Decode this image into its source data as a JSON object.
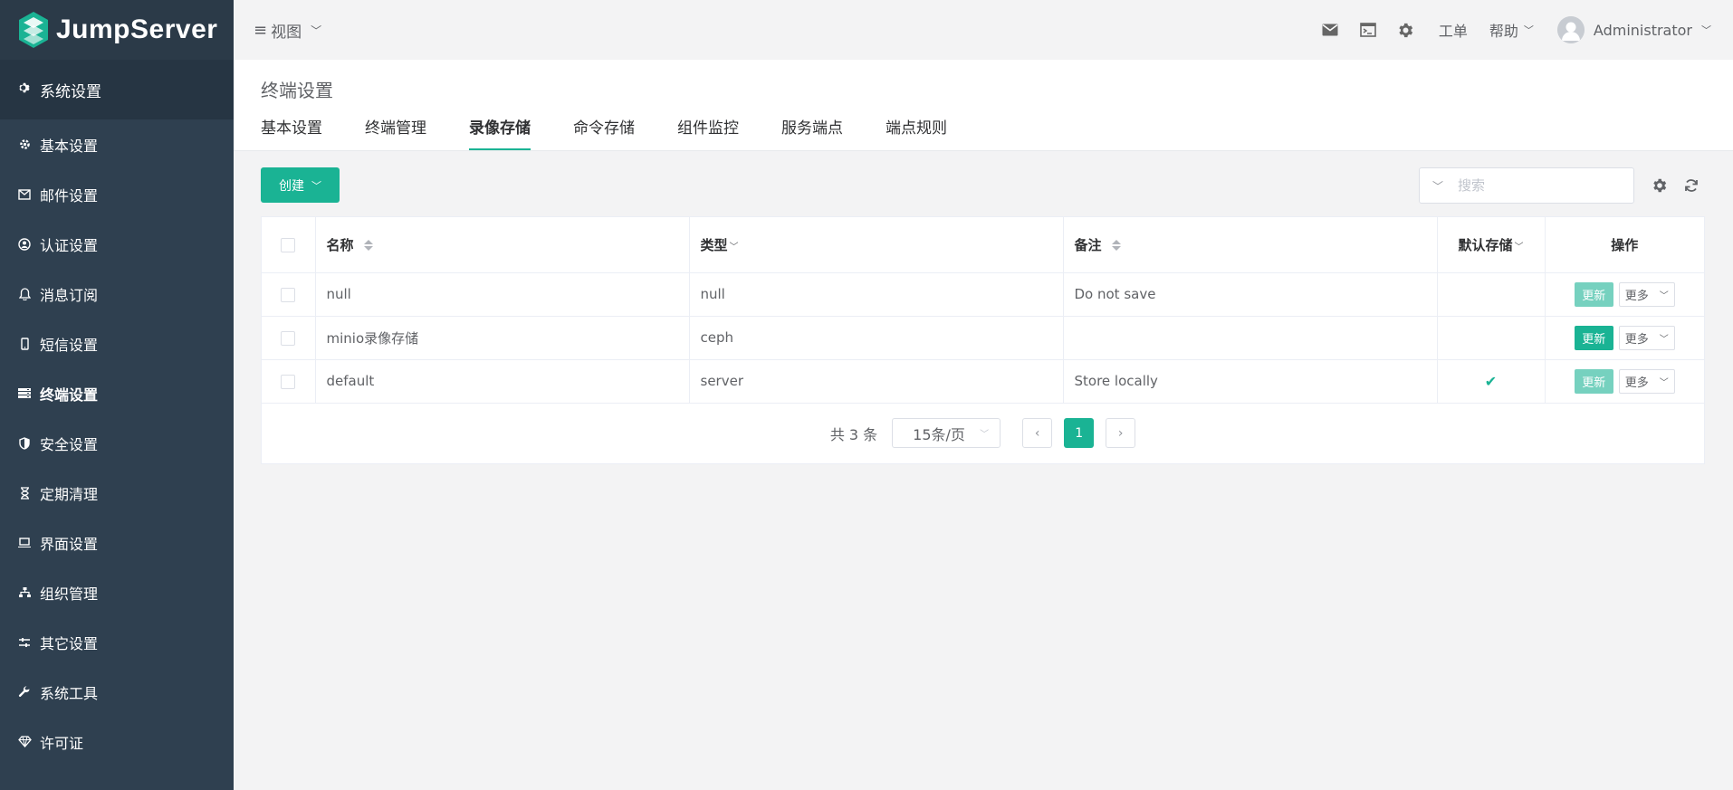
{
  "brand": {
    "name": "JumpServer"
  },
  "sidebar": {
    "section_title": "系统设置",
    "items": [
      {
        "label": "基本设置",
        "icon": "gear-icon",
        "active": false
      },
      {
        "label": "邮件设置",
        "icon": "envelope-icon",
        "active": false
      },
      {
        "label": "认证设置",
        "icon": "user-circle-icon",
        "active": false
      },
      {
        "label": "消息订阅",
        "icon": "bell-icon",
        "active": false
      },
      {
        "label": "短信设置",
        "icon": "mobile-icon",
        "active": false
      },
      {
        "label": "终端设置",
        "icon": "server-icon",
        "active": true
      },
      {
        "label": "安全设置",
        "icon": "shield-icon",
        "active": false
      },
      {
        "label": "定期清理",
        "icon": "hourglass-icon",
        "active": false
      },
      {
        "label": "界面设置",
        "icon": "laptop-icon",
        "active": false
      },
      {
        "label": "组织管理",
        "icon": "sitemap-icon",
        "active": false
      },
      {
        "label": "其它设置",
        "icon": "sliders-icon",
        "active": false
      },
      {
        "label": "系统工具",
        "icon": "wrench-icon",
        "active": false
      },
      {
        "label": "许可证",
        "icon": "diamond-icon",
        "active": false
      }
    ]
  },
  "topbar": {
    "view_label": "视图",
    "ticket_label": "工单",
    "help_label": "帮助",
    "user_name": "Administrator"
  },
  "page": {
    "title": "终端设置",
    "tabs": [
      {
        "label": "基本设置",
        "active": false
      },
      {
        "label": "终端管理",
        "active": false
      },
      {
        "label": "录像存储",
        "active": true
      },
      {
        "label": "命令存储",
        "active": false
      },
      {
        "label": "组件监控",
        "active": false
      },
      {
        "label": "服务端点",
        "active": false
      },
      {
        "label": "端点规则",
        "active": false
      }
    ]
  },
  "toolbar": {
    "create_label": "创建",
    "search_placeholder": "搜索"
  },
  "table": {
    "headers": {
      "name": "名称",
      "type": "类型",
      "comment": "备注",
      "default": "默认存储",
      "actions": "操作"
    },
    "rows": [
      {
        "name": "null",
        "type": "null",
        "comment": "Do not save",
        "is_default": false,
        "update_enabled": false
      },
      {
        "name": "minio录像存储",
        "type": "ceph",
        "comment": "",
        "is_default": false,
        "update_enabled": true
      },
      {
        "name": "default",
        "type": "server",
        "comment": "Store locally",
        "is_default": true,
        "update_enabled": false
      }
    ],
    "update_label": "更新",
    "more_label": "更多"
  },
  "pagination": {
    "total_text": "共 3 条",
    "page_size_text": "15条/页",
    "current_page": "1"
  },
  "colors": {
    "sidebar_bg": "#2f4050",
    "accent": "#1ab394",
    "page_bg": "#f3f3f4"
  }
}
